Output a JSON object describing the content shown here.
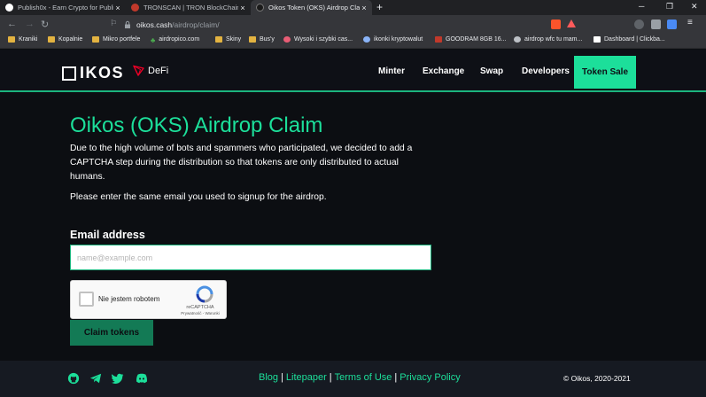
{
  "browser": {
    "tabs": [
      {
        "title": "Publish0x - Earn Crypto for Publish",
        "favicon_color": "#ffffff",
        "active": false
      },
      {
        "title": "TRONSCAN | TRON BlockChain Ex",
        "favicon_color": "#c0392b",
        "active": false
      },
      {
        "title": "Oikos Token (OKS) Airdrop Claim",
        "favicon_color": "#1a1a1a",
        "active": true
      }
    ],
    "tab_close_glyph": "×",
    "new_tab_glyph": "+",
    "url_host": "oikos.cash",
    "url_path": "/airdrop/claim/",
    "shield_count": "0",
    "bookmarks": [
      {
        "label": "Kraniki",
        "icon": "folder-icon"
      },
      {
        "label": "Kopalnie",
        "icon": "folder-icon"
      },
      {
        "label": "Mikro portfele",
        "icon": "folder-icon"
      },
      {
        "label": "airdropico.com",
        "icon": "palm-icon"
      },
      {
        "label": "Skiny",
        "icon": "folder-icon"
      },
      {
        "label": "Bus'y",
        "icon": "folder-icon"
      },
      {
        "label": "Wysoki i szybki cas...",
        "icon": "globe-icon"
      },
      {
        "label": "ikonki kryptowalut",
        "icon": "globe-icon"
      },
      {
        "label": "GOODRAM 8GB 16...",
        "icon": "globe-icon"
      },
      {
        "label": "airdrop wfc tu mam...",
        "icon": "globe-icon"
      },
      {
        "label": "Dashboard | Clickba...",
        "icon": "globe-icon"
      }
    ]
  },
  "header": {
    "logo_text": "IKOS",
    "defi_label": "DeFi",
    "nav": [
      "Minter",
      "Exchange",
      "Swap",
      "Developers"
    ],
    "cta_label": "Token Sale"
  },
  "main": {
    "title": "Oikos (OKS) Airdrop Claim",
    "intro": "Due to the high volume of bots and spammers who participated, we decided to add a CAPTCHA step during the distribution so that tokens are only distributed to actual humans.",
    "instruction": "Please enter the same email you used to signup for the airdrop.",
    "email_label": "Email address",
    "email_placeholder": "name@example.com",
    "recaptcha": {
      "label": "Nie jestem robotem",
      "brand": "reCAPTCHA",
      "terms": "Prywatność - Warunki"
    },
    "submit_label": "Claim tokens"
  },
  "footer": {
    "links": [
      "Blog",
      "Litepaper",
      "Terms of Use",
      "Privacy Policy"
    ],
    "separator": "|",
    "copyright": "© Oikos, 2020-2021"
  },
  "colors": {
    "accent": "#1cdf9a",
    "accent_dark": "#137a55",
    "background": "#0c0e12",
    "footer_bg": "#161a22"
  }
}
